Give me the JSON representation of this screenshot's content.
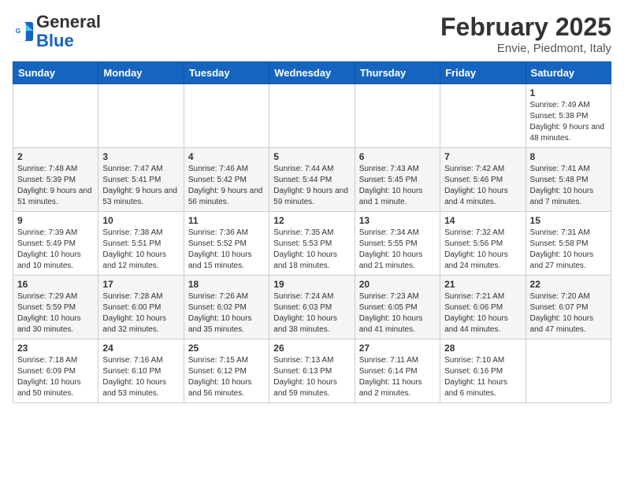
{
  "logo": {
    "general": "General",
    "blue": "Blue"
  },
  "title": "February 2025",
  "subtitle": "Envie, Piedmont, Italy",
  "days_of_week": [
    "Sunday",
    "Monday",
    "Tuesday",
    "Wednesday",
    "Thursday",
    "Friday",
    "Saturday"
  ],
  "weeks": [
    [
      {
        "day": "",
        "info": ""
      },
      {
        "day": "",
        "info": ""
      },
      {
        "day": "",
        "info": ""
      },
      {
        "day": "",
        "info": ""
      },
      {
        "day": "",
        "info": ""
      },
      {
        "day": "",
        "info": ""
      },
      {
        "day": "1",
        "info": "Sunrise: 7:49 AM\nSunset: 5:38 PM\nDaylight: 9 hours and 48 minutes."
      }
    ],
    [
      {
        "day": "2",
        "info": "Sunrise: 7:48 AM\nSunset: 5:39 PM\nDaylight: 9 hours and 51 minutes."
      },
      {
        "day": "3",
        "info": "Sunrise: 7:47 AM\nSunset: 5:41 PM\nDaylight: 9 hours and 53 minutes."
      },
      {
        "day": "4",
        "info": "Sunrise: 7:46 AM\nSunset: 5:42 PM\nDaylight: 9 hours and 56 minutes."
      },
      {
        "day": "5",
        "info": "Sunrise: 7:44 AM\nSunset: 5:44 PM\nDaylight: 9 hours and 59 minutes."
      },
      {
        "day": "6",
        "info": "Sunrise: 7:43 AM\nSunset: 5:45 PM\nDaylight: 10 hours and 1 minute."
      },
      {
        "day": "7",
        "info": "Sunrise: 7:42 AM\nSunset: 5:46 PM\nDaylight: 10 hours and 4 minutes."
      },
      {
        "day": "8",
        "info": "Sunrise: 7:41 AM\nSunset: 5:48 PM\nDaylight: 10 hours and 7 minutes."
      }
    ],
    [
      {
        "day": "9",
        "info": "Sunrise: 7:39 AM\nSunset: 5:49 PM\nDaylight: 10 hours and 10 minutes."
      },
      {
        "day": "10",
        "info": "Sunrise: 7:38 AM\nSunset: 5:51 PM\nDaylight: 10 hours and 12 minutes."
      },
      {
        "day": "11",
        "info": "Sunrise: 7:36 AM\nSunset: 5:52 PM\nDaylight: 10 hours and 15 minutes."
      },
      {
        "day": "12",
        "info": "Sunrise: 7:35 AM\nSunset: 5:53 PM\nDaylight: 10 hours and 18 minutes."
      },
      {
        "day": "13",
        "info": "Sunrise: 7:34 AM\nSunset: 5:55 PM\nDaylight: 10 hours and 21 minutes."
      },
      {
        "day": "14",
        "info": "Sunrise: 7:32 AM\nSunset: 5:56 PM\nDaylight: 10 hours and 24 minutes."
      },
      {
        "day": "15",
        "info": "Sunrise: 7:31 AM\nSunset: 5:58 PM\nDaylight: 10 hours and 27 minutes."
      }
    ],
    [
      {
        "day": "16",
        "info": "Sunrise: 7:29 AM\nSunset: 5:59 PM\nDaylight: 10 hours and 30 minutes."
      },
      {
        "day": "17",
        "info": "Sunrise: 7:28 AM\nSunset: 6:00 PM\nDaylight: 10 hours and 32 minutes."
      },
      {
        "day": "18",
        "info": "Sunrise: 7:26 AM\nSunset: 6:02 PM\nDaylight: 10 hours and 35 minutes."
      },
      {
        "day": "19",
        "info": "Sunrise: 7:24 AM\nSunset: 6:03 PM\nDaylight: 10 hours and 38 minutes."
      },
      {
        "day": "20",
        "info": "Sunrise: 7:23 AM\nSunset: 6:05 PM\nDaylight: 10 hours and 41 minutes."
      },
      {
        "day": "21",
        "info": "Sunrise: 7:21 AM\nSunset: 6:06 PM\nDaylight: 10 hours and 44 minutes."
      },
      {
        "day": "22",
        "info": "Sunrise: 7:20 AM\nSunset: 6:07 PM\nDaylight: 10 hours and 47 minutes."
      }
    ],
    [
      {
        "day": "23",
        "info": "Sunrise: 7:18 AM\nSunset: 6:09 PM\nDaylight: 10 hours and 50 minutes."
      },
      {
        "day": "24",
        "info": "Sunrise: 7:16 AM\nSunset: 6:10 PM\nDaylight: 10 hours and 53 minutes."
      },
      {
        "day": "25",
        "info": "Sunrise: 7:15 AM\nSunset: 6:12 PM\nDaylight: 10 hours and 56 minutes."
      },
      {
        "day": "26",
        "info": "Sunrise: 7:13 AM\nSunset: 6:13 PM\nDaylight: 10 hours and 59 minutes."
      },
      {
        "day": "27",
        "info": "Sunrise: 7:11 AM\nSunset: 6:14 PM\nDaylight: 11 hours and 2 minutes."
      },
      {
        "day": "28",
        "info": "Sunrise: 7:10 AM\nSunset: 6:16 PM\nDaylight: 11 hours and 6 minutes."
      },
      {
        "day": "",
        "info": ""
      }
    ]
  ]
}
